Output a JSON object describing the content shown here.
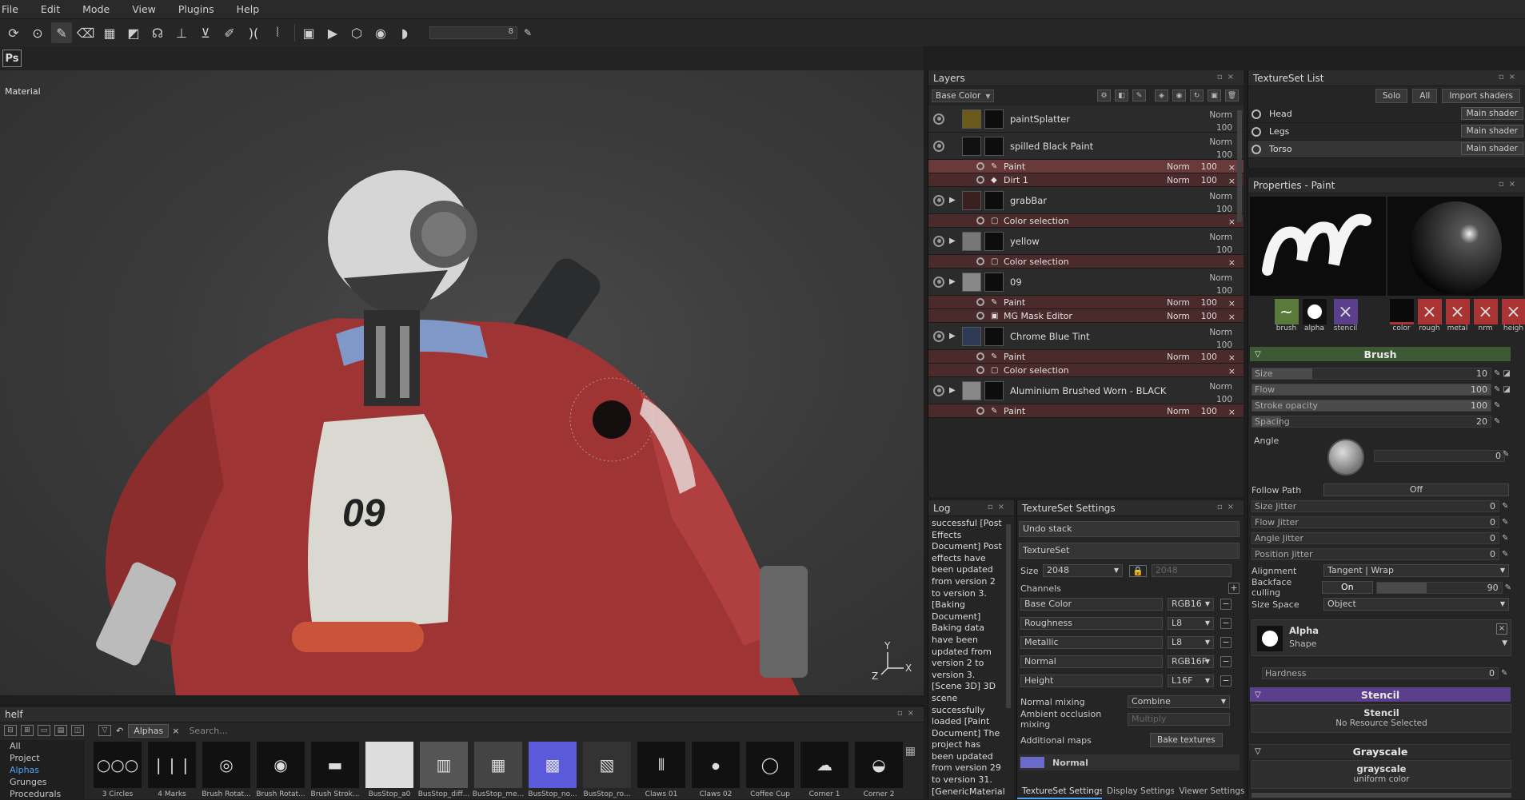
{
  "menu": [
    "File",
    "Edit",
    "Mode",
    "View",
    "Plugins",
    "Help"
  ],
  "toolbar": {
    "slider_value": "8"
  },
  "ps_label": "Ps",
  "viewport": {
    "label": "Material",
    "chest_number": "09"
  },
  "shelf": {
    "title": "helf",
    "filter": "Alphas",
    "search_placeholder": "Search...",
    "categories": [
      "All",
      "Project",
      "Alphas",
      "Grunges",
      "Procedurals"
    ],
    "items": [
      "3 Circles",
      "4 Marks",
      "Brush Rotat...",
      "Brush Rotat...",
      "Brush Strok...",
      "BusStop_a0",
      "BusStop_diff...",
      "BusStop_me...",
      "BusStop_no...",
      "BusStop_ro...",
      "Claws 01",
      "Claws 02",
      "Coffee Cup",
      "Corner 1",
      "Corner 2"
    ]
  },
  "layers": {
    "title": "Layers",
    "channel": "Base Color",
    "rows": [
      {
        "name": "paintSplatter",
        "blend": "Norm",
        "opacity": "100"
      },
      {
        "name": "spilled Black Paint",
        "blend": "Norm",
        "opacity": "100"
      },
      {
        "name": "grabBar",
        "blend": "Norm",
        "opacity": "100"
      },
      {
        "name": "yellow",
        "blend": "Norm",
        "opacity": "100"
      },
      {
        "name": "09",
        "blend": "Norm",
        "opacity": "100"
      },
      {
        "name": "Chrome Blue Tint",
        "blend": "Norm",
        "opacity": "100"
      },
      {
        "name": "Aluminium Brushed Worn - BLACK",
        "blend": "Norm",
        "opacity": "100"
      }
    ],
    "subs": [
      {
        "name": "Paint",
        "blend": "Norm",
        "opacity": "100"
      },
      {
        "name": "Dirt 1",
        "blend": "Norm",
        "opacity": "100"
      },
      {
        "name": "Color selection"
      },
      {
        "name": "Color selection"
      },
      {
        "name": "Paint",
        "blend": "Norm",
        "opacity": "100"
      },
      {
        "name": "MG Mask Editor",
        "blend": "Norm",
        "opacity": "100"
      },
      {
        "name": "Paint",
        "blend": "Norm",
        "opacity": "100"
      },
      {
        "name": "Color selection"
      },
      {
        "name": "Paint",
        "blend": "Norm",
        "opacity": "100"
      }
    ]
  },
  "tsl": {
    "title": "TextureSet List",
    "solo": "Solo",
    "all": "All",
    "import": "Import shaders",
    "items": [
      {
        "name": "Head",
        "shader": "Main shader"
      },
      {
        "name": "Legs",
        "shader": "Main shader"
      },
      {
        "name": "Torso",
        "shader": "Main shader"
      }
    ]
  },
  "props": {
    "title": "Properties - Paint",
    "slots_left": [
      "brush",
      "alpha",
      "stencil"
    ],
    "slots_right": [
      "color",
      "rough",
      "metal",
      "nrm",
      "heigh"
    ],
    "brush_section": "Brush",
    "size": {
      "label": "Size",
      "value": "10"
    },
    "flow": {
      "label": "Flow",
      "value": "100"
    },
    "stroke_opacity": {
      "label": "Stroke opacity",
      "value": "100"
    },
    "spacing": {
      "label": "Spacing",
      "value": "20"
    },
    "angle": {
      "label": "Angle",
      "value": "0"
    },
    "follow_path": {
      "label": "Follow Path",
      "value": "Off"
    },
    "size_jitter": {
      "label": "Size Jitter",
      "value": "0"
    },
    "flow_jitter": {
      "label": "Flow Jitter",
      "value": "0"
    },
    "angle_jitter": {
      "label": "Angle Jitter",
      "value": "0"
    },
    "position_jitter": {
      "label": "Position Jitter",
      "value": "0"
    },
    "alignment": {
      "label": "Alignment",
      "value": "Tangent | Wrap"
    },
    "backface": {
      "label": "Backface culling",
      "toggle": "On",
      "value": "90"
    },
    "size_space": {
      "label": "Size Space",
      "value": "Object"
    },
    "alpha_title": "Alpha",
    "alpha_sub": "Shape",
    "hardness": {
      "label": "Hardness",
      "value": "0"
    },
    "stencil_section": "Stencil",
    "stencil_title": "Stencil",
    "stencil_sub": "No Resource Selected",
    "grayscale_section": "Grayscale",
    "grayscale_title": "grayscale",
    "grayscale_sub": "uniform color"
  },
  "log": {
    "title": "Log",
    "text": "successful [Post Effects Document] Post effects have been updated from version 2 to version 3. [Baking Document] Baking data have been updated from version 2 to version 3. [Scene 3D] 3D scene successfully loaded [Paint Document] The project has been updated from version 29 to version 31. [GenericMaterial] Creation of the shader pbr-"
  },
  "tss": {
    "title": "TextureSet Settings",
    "undo": "Undo stack",
    "textureset": "TextureSet",
    "size_label": "Size",
    "size_value": "2048",
    "size_value2": "2048",
    "channels_label": "Channels",
    "channels": [
      {
        "name": "Base Color",
        "format": "RGB16"
      },
      {
        "name": "Roughness",
        "format": "L8"
      },
      {
        "name": "Metallic",
        "format": "L8"
      },
      {
        "name": "Normal",
        "format": "RGB16F"
      },
      {
        "name": "Height",
        "format": "L16F"
      }
    ],
    "normal_mixing_label": "Normal mixing",
    "normal_mixing_value": "Combine",
    "ao_mixing_label": "Ambient occlusion mixing",
    "ao_mixing_value": "Multiply",
    "additional_label": "Additional maps",
    "bake_button": "Bake textures",
    "normal_map": "Normal",
    "tabs": [
      "TextureSet Settings",
      "Display Settings",
      "Viewer Settings"
    ]
  },
  "colors": {
    "accent_blue": "#4fa3ff",
    "layer_sub_red": "#4a2a2a",
    "stencil_purple": "#5b3f8c",
    "brush_green": "#3d5a35",
    "jacket_red": "#a83a3a"
  }
}
